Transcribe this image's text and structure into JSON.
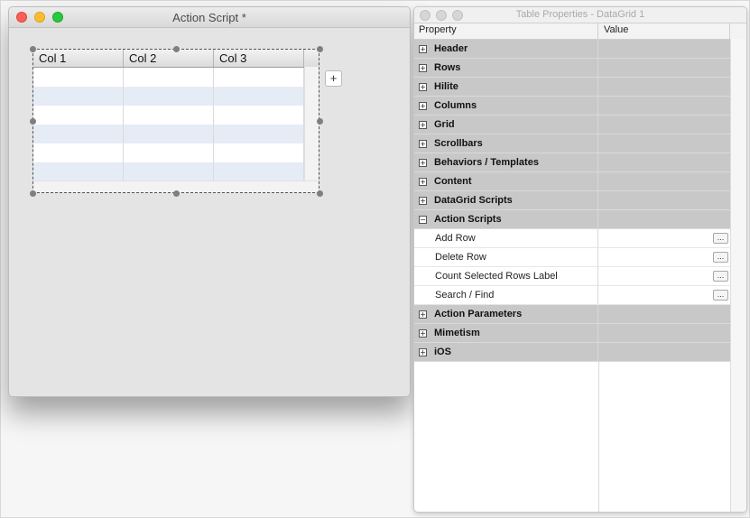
{
  "left_window": {
    "title": "Action Script *",
    "datagrid": {
      "columns": [
        "Col 1",
        "Col 2",
        "Col 3"
      ],
      "row_count": 6
    },
    "add_button_label": "+"
  },
  "right_window": {
    "title": "Table Properties - DataGrid 1",
    "header": {
      "property": "Property",
      "value": "Value"
    },
    "groups_before": [
      {
        "label": "Header",
        "expander": "+"
      },
      {
        "label": "Rows",
        "expander": "+"
      },
      {
        "label": "Hilite",
        "expander": "+"
      },
      {
        "label": "Columns",
        "expander": "+"
      },
      {
        "label": "Grid",
        "expander": "+"
      },
      {
        "label": "Scrollbars",
        "expander": "+"
      },
      {
        "label": "Behaviors / Templates",
        "expander": "+"
      },
      {
        "label": "Content",
        "expander": "+"
      },
      {
        "label": "DataGrid Scripts",
        "expander": "+"
      }
    ],
    "expanded_group": {
      "label": "Action Scripts",
      "expander": "−"
    },
    "action_items": [
      {
        "label": "Add Row",
        "button": "..."
      },
      {
        "label": "Delete Row",
        "button": "..."
      },
      {
        "label": "Count Selected Rows Label",
        "button": "..."
      },
      {
        "label": "Search / Find",
        "button": "..."
      }
    ],
    "groups_after": [
      {
        "label": "Action Parameters",
        "expander": "+"
      },
      {
        "label": "Mimetism",
        "expander": "+"
      },
      {
        "label": "iOS",
        "expander": "+"
      }
    ]
  }
}
